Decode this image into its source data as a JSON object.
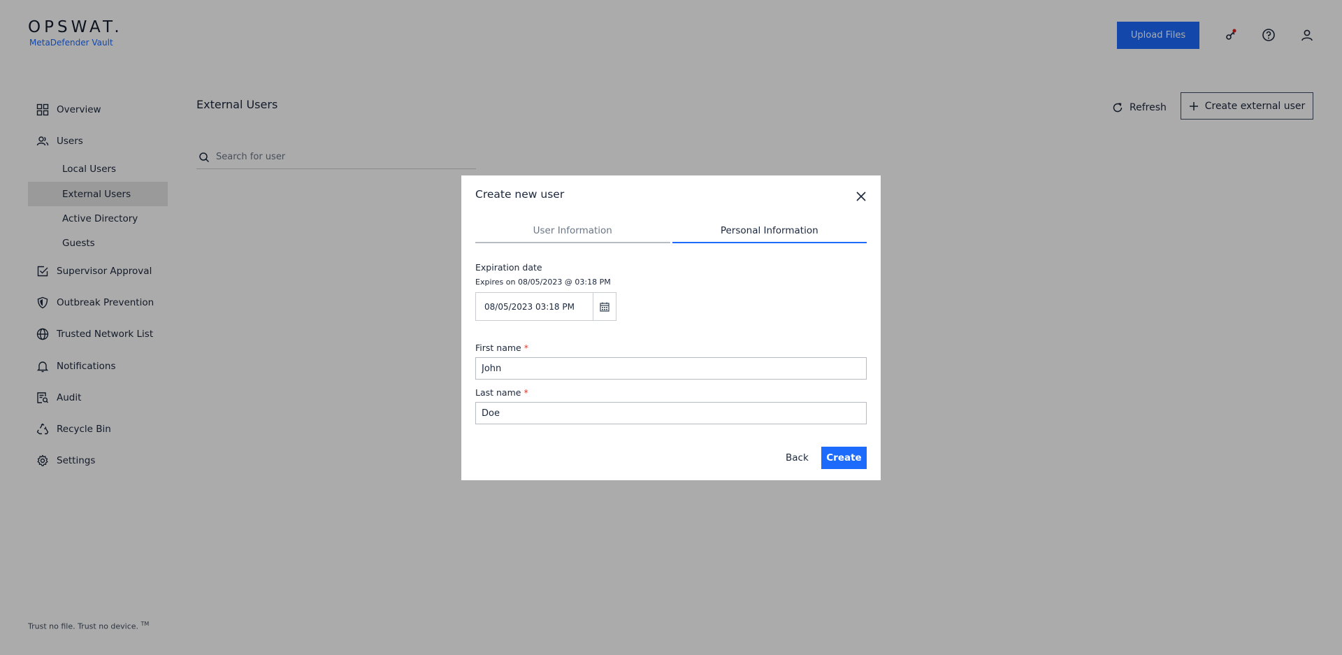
{
  "header": {
    "brand": "OPSWAT.",
    "product": "MetaDefender Vault",
    "upload_label": "Upload Files"
  },
  "sidebar": {
    "items": [
      {
        "label": "Overview",
        "icon": "grid-icon"
      },
      {
        "label": "Users",
        "icon": "users-icon"
      },
      {
        "label": "Supervisor Approval",
        "icon": "checkbox-icon"
      },
      {
        "label": "Outbreak Prevention",
        "icon": "shield-icon"
      },
      {
        "label": "Trusted Network List",
        "icon": "globe-icon"
      },
      {
        "label": "Notifications",
        "icon": "bell-icon"
      },
      {
        "label": "Audit",
        "icon": "audit-icon"
      },
      {
        "label": "Recycle Bin",
        "icon": "recycle-icon"
      },
      {
        "label": "Settings",
        "icon": "gear-icon"
      }
    ],
    "sub_items": [
      {
        "label": "Local Users"
      },
      {
        "label": "External Users"
      },
      {
        "label": "Active Directory"
      },
      {
        "label": "Guests"
      }
    ],
    "footer": "Trust no file. Trust no device.",
    "footer_tm": "TM"
  },
  "main": {
    "title": "External Users",
    "refresh_label": "Refresh",
    "create_label": "Create external user",
    "search_placeholder": "Search for user"
  },
  "modal": {
    "title": "Create new user",
    "tabs": [
      {
        "label": "User Information"
      },
      {
        "label": "Personal Information"
      }
    ],
    "expiration_label": "Expiration date",
    "expires_text": "Expires on 08/05/2023 @ 03:18 PM",
    "date_value": "08/05/2023 03:18 PM",
    "first_name_label": "First name",
    "first_name_value": "John",
    "last_name_label": "Last name",
    "last_name_value": "Doe",
    "required_mark": "*",
    "back_label": "Back",
    "create_label": "Create"
  },
  "colors": {
    "accent": "#1d6bfc",
    "required": "#d63a2f",
    "notification_dot": "#e02020"
  }
}
